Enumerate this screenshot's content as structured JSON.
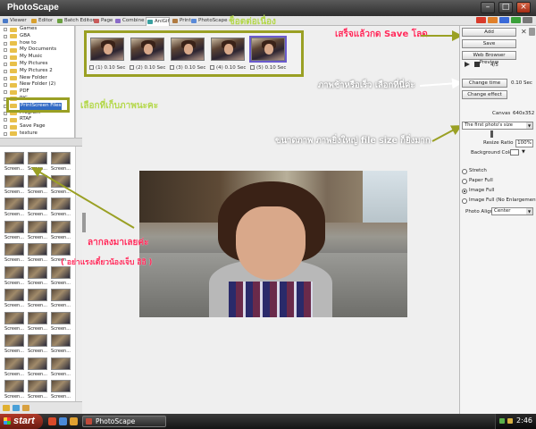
{
  "window": {
    "title": "PhotoScape"
  },
  "tabs": [
    {
      "label": "Viewer",
      "color": "#4a7ac8"
    },
    {
      "label": "Editor",
      "color": "#d8a030"
    },
    {
      "label": "Batch Editor",
      "color": "#6aa040"
    },
    {
      "label": "Page",
      "color": "#c85a5a"
    },
    {
      "label": "Combine",
      "color": "#8a6ac8"
    },
    {
      "label": "AniGif",
      "color": "#3aa0a0"
    },
    {
      "label": "Print",
      "color": "#b07a40"
    },
    {
      "label": "PhotoScape",
      "color": "#5a8ad8"
    }
  ],
  "active_tab": "AniGif",
  "toolbar_icons": [
    {
      "name": "red-tool-icon",
      "label": "",
      "color": "#d83a2a"
    },
    {
      "name": "orange-tool-icon",
      "label": "",
      "color": "#e0802a"
    },
    {
      "name": "blue-tool-icon",
      "label": "",
      "color": "#3a6ad8"
    },
    {
      "name": "green-tool-icon",
      "label": "",
      "color": "#3aa03a"
    },
    {
      "name": "gray-tool-icon",
      "label": "",
      "color": "#777777"
    }
  ],
  "folder_tree": [
    {
      "label": "Games",
      "selected": false
    },
    {
      "label": "GBA",
      "selected": false
    },
    {
      "label": "how to",
      "selected": false
    },
    {
      "label": "My Documents",
      "selected": false
    },
    {
      "label": "My Music",
      "selected": false
    },
    {
      "label": "My Pictures",
      "selected": false
    },
    {
      "label": "My Pictures 2",
      "selected": false
    },
    {
      "label": "New Folder",
      "selected": false
    },
    {
      "label": "New Folder (2)",
      "selected": false
    },
    {
      "label": "PDF",
      "selected": false
    },
    {
      "label": "PIC",
      "selected": false
    },
    {
      "label": "PrintScreen Files",
      "selected": true
    },
    {
      "label": "Program",
      "selected": false
    },
    {
      "label": "RTAF",
      "selected": false
    },
    {
      "label": "Save Page",
      "selected": false
    },
    {
      "label": "texture",
      "selected": false
    }
  ],
  "thumb_caption": "Screen...",
  "frames": [
    {
      "delay": "(1) 0.10 Sec",
      "selected": false
    },
    {
      "delay": "(2) 0.10 Sec",
      "selected": false
    },
    {
      "delay": "(3) 0.10 Sec",
      "selected": false
    },
    {
      "delay": "(4) 0.10 Sec",
      "selected": false
    },
    {
      "delay": "(5) 0.10 Sec",
      "selected": true
    }
  ],
  "right_panel": {
    "add": "Add",
    "save": "Save",
    "web_preview": "Web Browser Preview",
    "frame_counter": "4/5",
    "change_time": "Change time",
    "time_value": "0.10 Sec",
    "change_effect": "Change effect",
    "canvas_label": "Canvas",
    "canvas_size": "640x352",
    "size_select": "The first photo's size",
    "resize_label": "Resize Ratio",
    "resize_value": "100%",
    "bg_label": "Background Color",
    "radios": [
      {
        "label": "Stretch",
        "on": false
      },
      {
        "label": "Paper Full",
        "on": false
      },
      {
        "label": "Image Full",
        "on": true
      },
      {
        "label": "Image Full (No Enlargement)",
        "on": false
      }
    ],
    "align_label": "Photo Align",
    "align_value": "Center"
  },
  "annotations": {
    "frames": "ช็อตต่อเนื่อง",
    "save": "เสร็จแล้วกด Save โลด",
    "speed": "ภาพช้าหรือเร็ว เลือกที่นี่ค่ะ",
    "folder": "เลือกที่เก็บภาพนะคะ",
    "size": "ขนาดภาพ ภาพยิ่งใหญ่ file size ก็ยิ่งมาก",
    "drag": "ลากลงมาเลยค่ะ",
    "drag_note": "( อย่าแรงเดี๋ยวน้องเจ็บ อิอิ )"
  },
  "taskbar": {
    "start": "start",
    "app": "PhotoScape",
    "clock": "2:46"
  }
}
